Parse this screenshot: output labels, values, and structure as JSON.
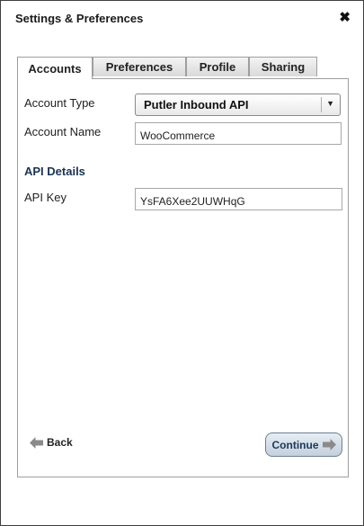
{
  "window": {
    "title": "Settings & Preferences",
    "close_icon": "close-icon",
    "close_glyph": "✖"
  },
  "tabs": [
    {
      "label": "Accounts",
      "active": true
    },
    {
      "label": "Preferences",
      "active": false
    },
    {
      "label": "Profile",
      "active": false
    },
    {
      "label": "Sharing",
      "active": false
    }
  ],
  "form": {
    "account_type": {
      "label": "Account Type",
      "value": "Putler Inbound API",
      "icon": "dropdown-arrow-icon"
    },
    "account_name": {
      "label": "Account Name",
      "value": "WooCommerce"
    },
    "api_section_title": "API Details",
    "api_key": {
      "label": "API Key",
      "value": "YsFA6Xee2UUWHqG"
    }
  },
  "footer": {
    "back_label": "Back",
    "back_icon": "arrow-left-icon",
    "continue_label": "Continue",
    "continue_icon": "arrow-right-icon"
  },
  "colors": {
    "section_title": "#1a3350",
    "continue_bg": "#c4d0dc",
    "arrow": "#8a8a8a"
  }
}
